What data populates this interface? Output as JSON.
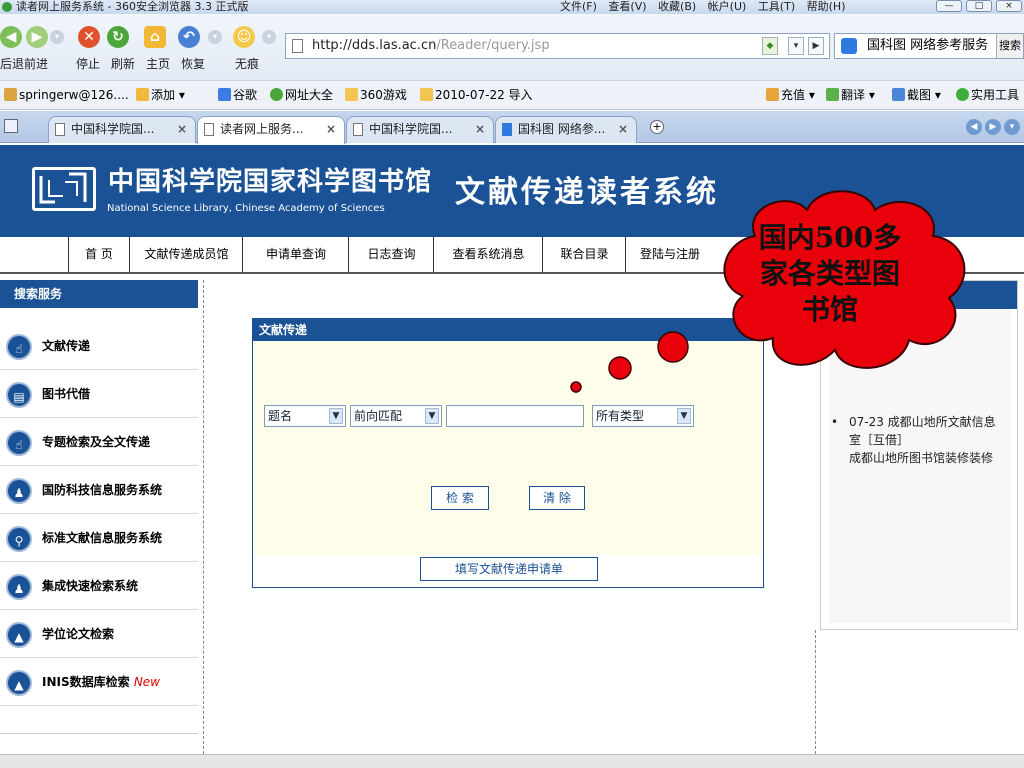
{
  "window": {
    "title": "读者网上服务系统 - 360安全浏览器 3.3 正式版",
    "menu": [
      "文件(F)",
      "查看(V)",
      "收藏(B)",
      "帐户(U)",
      "工具(T)",
      "帮助(H)"
    ]
  },
  "toolbar": {
    "back": "后退",
    "forward": "前进",
    "stop": "停止",
    "refresh": "刷新",
    "home": "主页",
    "restore": "恢复",
    "incognito": "无痕",
    "url_host": "http://dds.las.ac.cn",
    "url_path": "/Reader/query.jsp",
    "search_text": "国科图 网络参考服务",
    "search_button": "搜索"
  },
  "bookmarks": {
    "left": [
      "springerw@126....",
      "添加",
      "谷歌",
      "网址大全",
      "360游戏",
      "2010-07-22 导入"
    ],
    "right": [
      "充值",
      "翻译",
      "截图",
      "实用工具"
    ]
  },
  "tabs": [
    {
      "label": "中国科学院国..."
    },
    {
      "label": "读者网上服务..."
    },
    {
      "label": "中国科学院国..."
    },
    {
      "label": "国科图 网络参..."
    }
  ],
  "header": {
    "library_cn": "中国科学院国家科学图书馆",
    "library_en": "National Science Library, Chinese Academy of Sciences",
    "system": "文献传递读者系统"
  },
  "site_nav": [
    "首 页",
    "文献传递成员馆",
    "申请单查询",
    "日志查询",
    "查看系统消息",
    "联合目录",
    "登陆与注册"
  ],
  "sidebar": {
    "title": "搜索服务",
    "items": [
      {
        "label": "文献传递"
      },
      {
        "label": "图书代借"
      },
      {
        "label": "专题检索及全文传递"
      },
      {
        "label": "国防科技信息服务系统"
      },
      {
        "label": "标准文献信息服务系统"
      },
      {
        "label": "集成快速检索系统"
      },
      {
        "label": "学位论文检索"
      },
      {
        "label": "INIS数据库检索",
        "badge": "New"
      }
    ]
  },
  "form": {
    "title": "文献传递",
    "field": "题名",
    "match": "前向匹配",
    "query": "",
    "type": "所有类型",
    "search_button": "检 索",
    "clear_button": "清 除",
    "fill_button": "填写文献传递申请单"
  },
  "news": {
    "items": [
      {
        "line1": "07-23 成都山地所文献信息室［互借］",
        "line2": "成都山地所图书馆装修装修"
      }
    ]
  },
  "callout": {
    "text": "国内500多家各类型图书馆"
  },
  "colors": {
    "brand": "#1a5295",
    "form_bg": "#fdfde9",
    "new_badge": "#dd0000",
    "callout_red": "#e8000a"
  }
}
